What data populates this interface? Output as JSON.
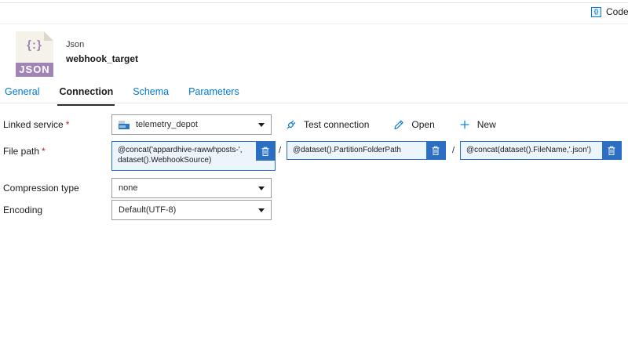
{
  "topbar": {
    "code_button": "Code"
  },
  "header": {
    "type": "Json",
    "name": "webhook_target",
    "icon": {
      "braces": "{:}",
      "label": "JSON"
    }
  },
  "tabs": {
    "general": "General",
    "connection": "Connection",
    "schema": "Schema",
    "parameters": "Parameters"
  },
  "form": {
    "required_marker": "*",
    "linked_service": {
      "label": "Linked service",
      "value": "telemetry_depot"
    },
    "actions": {
      "test_connection": "Test connection",
      "open": "Open",
      "new": "New"
    },
    "file_path": {
      "label": "File path",
      "separator": "/",
      "container": "@concat('appardhive-rawwhposts-', dataset().WebhookSource)",
      "directory": "@dataset().PartitionFolderPath",
      "file": "@concat(dataset().FileName,'.json')"
    },
    "compression_type": {
      "label": "Compression type",
      "value": "none"
    },
    "encoding": {
      "label": "Encoding",
      "value": "Default(UTF-8)"
    }
  },
  "colors": {
    "accent": "#0078d4",
    "field_border": "#2b6fc2",
    "field_background": "#ecf4fc",
    "trash_background": "#2b6fc2",
    "icon_purple": "#a184b5",
    "required": "#a4262c"
  }
}
